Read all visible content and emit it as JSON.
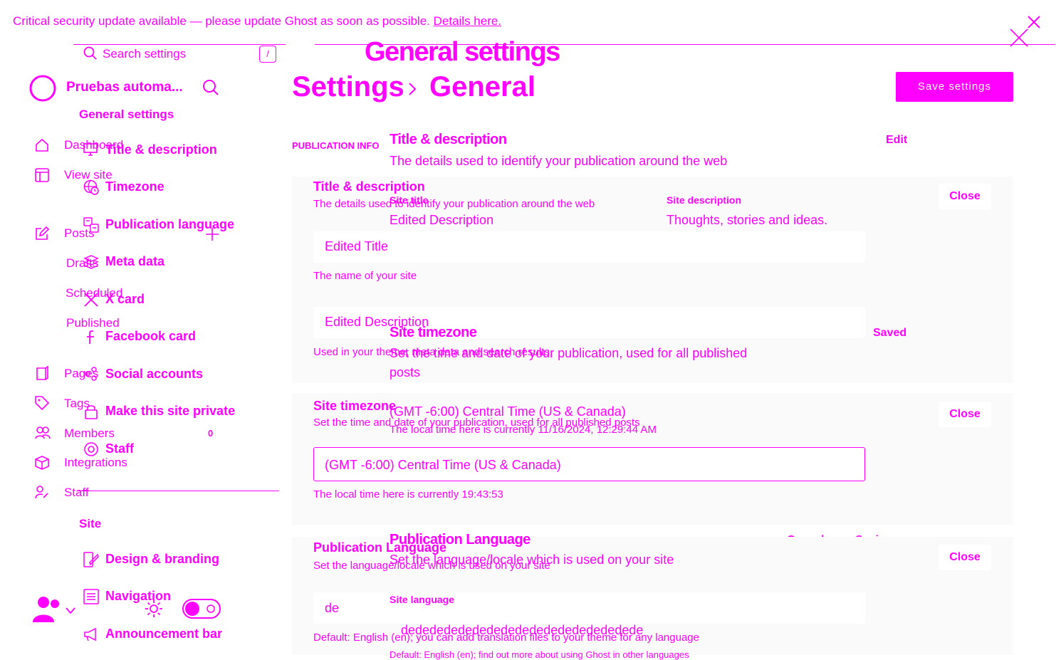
{
  "banner": {
    "text": "Critical security update available — please update Ghost as soon as possible.",
    "link": "Details here."
  },
  "search": {
    "placeholder": "Search settings",
    "shortcut": "/"
  },
  "page_heading": "General settings",
  "breadcrumb": {
    "root": "Settings",
    "current": "General"
  },
  "save_button": "Save settings",
  "site_name": "Pruebas automa...",
  "settings_nav": {
    "group_general": "General settings",
    "items": [
      "Title & description",
      "Timezone",
      "Publication language",
      "Meta data",
      "X card",
      "Facebook card",
      "Social accounts",
      "Make this site private",
      "Staff"
    ],
    "group_site": "Site",
    "site_items": [
      "Design & branding",
      "Navigation",
      "Announcement bar"
    ]
  },
  "admin_nav": {
    "dashboard": "Dashboard",
    "view_site": "View site",
    "posts": "Posts",
    "drafts": "Drafts",
    "scheduled": "Scheduled",
    "published": "Published",
    "pages": "Pages",
    "tags": "Tags",
    "members": "Members",
    "members_count": "0",
    "integrations": "Integrations",
    "staff": "Staff"
  },
  "publication_info": "PUBLICATION INFO",
  "title_section": {
    "heading": "Title & description",
    "desc": "The details used to identify your publication around the web",
    "edit": "Edit",
    "site_title_label": "Site title",
    "site_title_value": "Edited Description",
    "site_desc_label": "Site description",
    "site_desc_value": "Thoughts, stories and ideas.",
    "inner_heading": "Title & description",
    "inner_desc": "The details used to identify your publication around the web",
    "close": "Close",
    "title_input": "Edited Title",
    "title_hint": "The name of your site",
    "desc_input": "Edited Description",
    "desc_hint": "Used in your theme, meta data and search results"
  },
  "timezone_section": {
    "heading": "Site timezone",
    "status": "Saved",
    "desc_line1": "Set the time and date of your publication, used for all published",
    "desc_line2": "posts",
    "inner_heading": "Site timezone",
    "inner_desc": "Set the time and date of your publication, used for all published posts",
    "close": "Close",
    "current_value": "(GMT -6:00) Central Time (US & Canada)",
    "local_time_old": "The local time here is currently 11/16/2024, 12:29:44 AM",
    "select_value": "(GMT -6:00) Central Time (US & Canada)",
    "local_time": "The local time here is currently 19:43:53"
  },
  "language_section": {
    "heading": "Publication Language",
    "cancel": "Cancel",
    "status": "Saving...",
    "desc": "Set the language/locale which is used on your site",
    "inner_heading": "Publication Language",
    "inner_desc": "Set the language/locale which is used on your site",
    "close": "Close",
    "site_language_label": "Site language",
    "input_value": "de",
    "repeated_value": "dedededededededededededededededede",
    "hint": "Default: English (en); you can add translation files to your theme for any language",
    "hint_cut": "Default: English (en); find out more about using Ghost in other languages"
  }
}
